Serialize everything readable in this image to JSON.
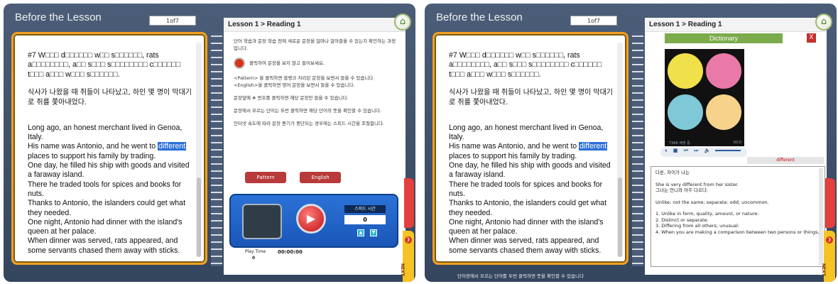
{
  "left": {
    "header_title": "Before the Lesson",
    "pager": "1of7",
    "passage": {
      "garbled": "#7 W□□□ d□□□□□□ w□□ s□□□□□□, rats a□□□□□□□□, a□□ s□□□ s□□□□□□□□ c□□□□□□ t□□□ a□□□ w□□□ s□□□□□□.",
      "korean": "식사가 나왔을 때 쥐들이 나타났고, 하인 몇 명이 막대기로 쥐를 쫓아내었다.",
      "lines": [
        "Long ago, an honest merchant lived in Genoa, Italy.",
        "His name was Antonio, and he went to",
        "places to support his family by trading.",
        "One day, he filled his ship with goods and visited a faraway island.",
        "There he traded tools for spices and books for nuts.",
        "Thanks to Antonio, the islanders could get what they needed.",
        "One night, Antonio had dinner with the island's queen at her palace.",
        "When dinner was served, rats appeared, and some servants chased them away with sticks."
      ],
      "highlight_word": "different"
    },
    "right_page": {
      "title": "Lesson 1 > Reading 1",
      "intro": "단어 학습과 문장 학습 전에 새로운 문장을 얼마나 알아들을 수 있는지 확인하는 과정입니다.",
      "play_hint": "클릭하여 문장을 보지 않고 들어보세요.",
      "tips": [
        "<Pattern> 을 클릭하면 블랭크 처리된 문장을 보면서 들을 수 있습니다. <English>을 클릭하면 영어 문장을 보면서 들을 수 있습니다.",
        "문장앞에 # 번호를 클릭하면 해당 문장만 들을 수 있습니다.",
        "문장에서 모르는 단어는 두번 클릭하면 해당 단어의 뜻을 확인할 수 있습니다.",
        "인터넷 속도에 따라 문장 듣기가 중단되는 경우에는 스피드 시간을 조절합니다."
      ],
      "buttons": [
        "Pattern",
        "English"
      ],
      "speed_label": "스피드 시간",
      "speed_value": "0",
      "play_time_label": "Play Time",
      "play_time_value": "00:00:00",
      "play_time_zero": "0",
      "next_tab": "NEXT"
    }
  },
  "right": {
    "header_title": "Before the Lesson",
    "pager": "1of7",
    "page_title": "Lesson 1 > Reading 1",
    "dictionary_label": "Dictionary",
    "close_label": "X",
    "video_caption": "7366 재생 중",
    "video_counter": "00:0",
    "word": "different",
    "definitions": [
      "다른, 차이가 나는",
      "She is very different from her sister.",
      "그녀는 언니와 아주 다르다.",
      "Unlike:  not the same; separate:  odd; uncommon.",
      "1. Unlike in form, quality, amount, or nature:",
      "2. Distinct or separate:",
      "3. Differing from all others; unusual:",
      "4. When you are making a comparison between two persons or things,"
    ],
    "footer": "단어장에서 모르는 단어를 두번 클릭하면 뜻을 확인할 수 있습니다",
    "next_tab": "NEXT"
  }
}
